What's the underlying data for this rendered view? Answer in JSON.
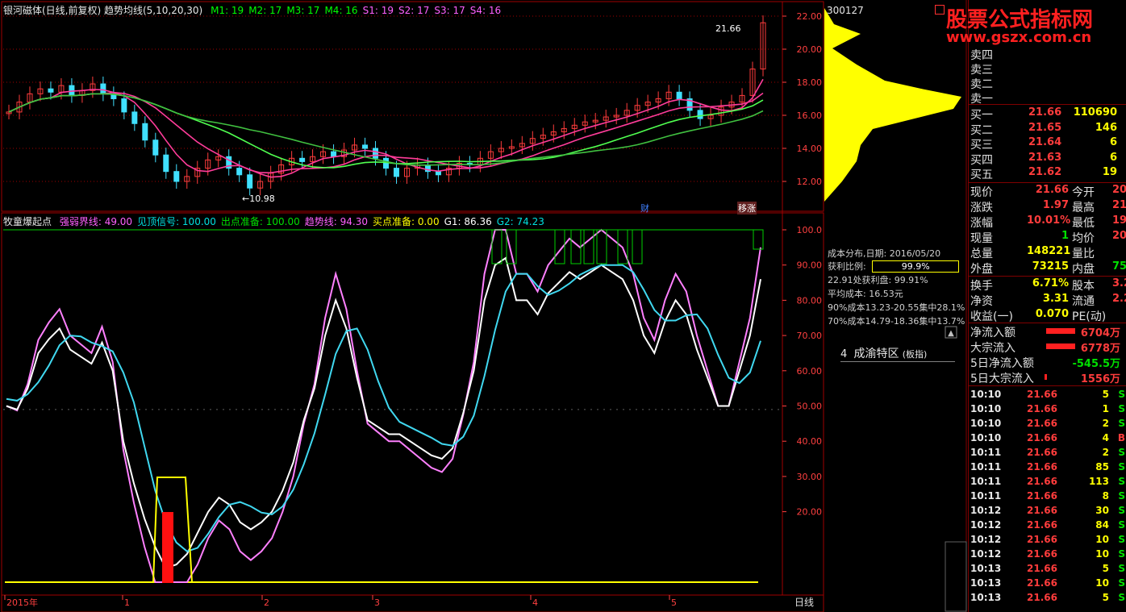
{
  "main": {
    "title": "银河磁体(日线,前复权) 趋势均线(5,10,20,30)",
    "ma": [
      {
        "label": "M1: 19",
        "color": "#ffffff"
      },
      {
        "label": "M2: 17",
        "color": "#ffff00"
      },
      {
        "label": "M3: 17",
        "color": "#ff60ff"
      },
      {
        "label": "M4: 16",
        "color": "#00ff00"
      },
      {
        "label": "S1: 19",
        "color": "#ff60ff"
      },
      {
        "label": "S2: 17",
        "color": "#ff60ff"
      },
      {
        "label": "S3: 17",
        "color": "#ff60ff"
      },
      {
        "label": "S4: 16",
        "color": "#ff60ff"
      }
    ],
    "price_ticks": [
      "22.00",
      "20.00",
      "18.00",
      "16.00",
      "14.00",
      "12.00"
    ],
    "low_label": "10.98",
    "high_label": "21.66",
    "badge_cai": "财",
    "badge_zhang": "移涨"
  },
  "sub": {
    "title": "牧童爆起点",
    "items": [
      {
        "label": "强弱界线: 49.00",
        "color": "#ff60ff"
      },
      {
        "label": "见顶信号: 100.00",
        "color": "#00e0e0"
      },
      {
        "label": "出点准备: 100.00",
        "color": "#00e000"
      },
      {
        "label": "趋势线: 94.30",
        "color": "#ff60ff"
      },
      {
        "label": "买点准备: 0.00",
        "color": "#ffff00"
      },
      {
        "label": "G1: 86.36",
        "color": "#ffffff"
      },
      {
        "label": "G2: 74.23",
        "color": "#00e0e0"
      }
    ],
    "ticks": [
      "100.0",
      "90.00",
      "80.00",
      "70.00",
      "60.00",
      "50.00",
      "40.00",
      "30.00",
      "20.00"
    ]
  },
  "xaxis": {
    "labels": [
      "2015年",
      "1",
      "2",
      "3",
      "4",
      "5"
    ],
    "period": "日线"
  },
  "profile": {
    "code": "300127",
    "date_line": "成本分布,日期: 2016/05/20",
    "profit_label": "获利比例:",
    "profit_value": "99.9%",
    "line1": "22.91处获利盘: 99.91%",
    "line2": "平均成本: 16.53元",
    "line3": "90%成本13.23-20.55集中28.1%",
    "line4": "70%成本14.79-18.36集中13.7%",
    "sector_num": "4",
    "sector_name": "成渝特区",
    "sector_tag": "(板指)"
  },
  "quote": {
    "watermark1": "股票公式指标网",
    "watermark2": "www.gszx.com.cn",
    "sell": [
      {
        "label": "卖四",
        "price": "",
        "vol": ""
      },
      {
        "label": "卖三",
        "price": "",
        "vol": ""
      },
      {
        "label": "卖二",
        "price": "",
        "vol": ""
      },
      {
        "label": "卖一",
        "price": "",
        "vol": ""
      }
    ],
    "buy": [
      {
        "label": "买一",
        "price": "21.66",
        "vol": "110690"
      },
      {
        "label": "买二",
        "price": "21.65",
        "vol": "146"
      },
      {
        "label": "买三",
        "price": "21.64",
        "vol": "6"
      },
      {
        "label": "买四",
        "price": "21.63",
        "vol": "6"
      },
      {
        "label": "买五",
        "price": "21.62",
        "vol": "19"
      }
    ],
    "stats": [
      {
        "l1": "现价",
        "v1": "21.66",
        "l2": "今开",
        "v2": "20"
      },
      {
        "l1": "涨跌",
        "v1": "1.97",
        "l2": "最高",
        "v2": "21"
      },
      {
        "l1": "涨幅",
        "v1": "10.01%",
        "l2": "最低",
        "v2": "19"
      },
      {
        "l1": "现量",
        "v1": "1",
        "l2": "均价",
        "v2": "20"
      },
      {
        "l1": "总量",
        "v1": "148221",
        "l2": "量比",
        "v2": ""
      },
      {
        "l1": "外盘",
        "v1": "73215",
        "l2": "内盘",
        "v2": "75"
      }
    ],
    "stats2": [
      {
        "l1": "换手",
        "v1": "6.71%",
        "l2": "股本",
        "v2": "3.2"
      },
      {
        "l1": "净资",
        "v1": "3.31",
        "l2": "流通",
        "v2": "2.2"
      },
      {
        "l1": "收益(一)",
        "v1": "0.070",
        "l2": "PE(动)",
        "v2": ""
      }
    ],
    "flows": [
      {
        "label": "净流入额",
        "value": "6704万"
      },
      {
        "label": "大宗流入",
        "value": "6778万"
      },
      {
        "label": "5日净流入额",
        "value": "-545.5万"
      },
      {
        "label": "5日大宗流入",
        "value": "1556万"
      }
    ],
    "ticks": [
      {
        "t": "10:10",
        "p": "21.66",
        "v": "5",
        "s": "S"
      },
      {
        "t": "10:10",
        "p": "21.66",
        "v": "1",
        "s": "S"
      },
      {
        "t": "10:10",
        "p": "21.66",
        "v": "2",
        "s": "S"
      },
      {
        "t": "10:10",
        "p": "21.66",
        "v": "4",
        "s": "B"
      },
      {
        "t": "10:11",
        "p": "21.66",
        "v": "2",
        "s": "S"
      },
      {
        "t": "10:11",
        "p": "21.66",
        "v": "85",
        "s": "S"
      },
      {
        "t": "10:11",
        "p": "21.66",
        "v": "113",
        "s": "S"
      },
      {
        "t": "10:11",
        "p": "21.66",
        "v": "8",
        "s": "S"
      },
      {
        "t": "10:12",
        "p": "21.66",
        "v": "30",
        "s": "S"
      },
      {
        "t": "10:12",
        "p": "21.66",
        "v": "84",
        "s": "S"
      },
      {
        "t": "10:12",
        "p": "21.66",
        "v": "10",
        "s": "S"
      },
      {
        "t": "10:12",
        "p": "21.66",
        "v": "10",
        "s": "S"
      },
      {
        "t": "10:13",
        "p": "21.66",
        "v": "5",
        "s": "S"
      },
      {
        "t": "10:13",
        "p": "21.66",
        "v": "10",
        "s": "S"
      },
      {
        "t": "10:13",
        "p": "21.66",
        "v": "5",
        "s": "S"
      }
    ]
  }
}
